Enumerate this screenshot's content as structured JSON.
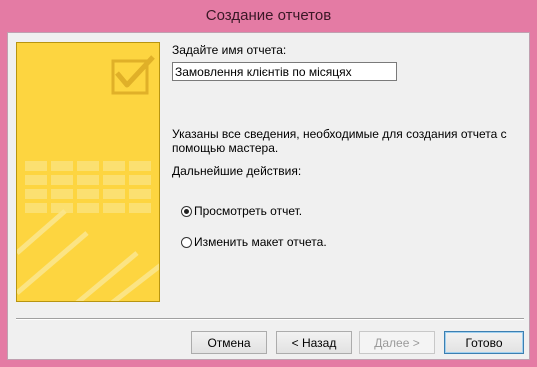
{
  "window": {
    "title": "Создание отчетов"
  },
  "form": {
    "name_label": "Задайте имя отчета:",
    "name_value": "Замовлення клієнтів по місяцях",
    "info_text_line1": "Указаны все сведения, необходимые для создания отчета с",
    "info_text_line2": "помощью мастера.",
    "next_actions_label": "Дальнейшие действия:",
    "options": [
      {
        "label": "Просмотреть отчет.",
        "checked": true
      },
      {
        "label": "Изменить макет отчета.",
        "checked": false
      }
    ]
  },
  "buttons": {
    "cancel": "Отмена",
    "back": "< Назад",
    "next": "Далее >",
    "finish": "Готово"
  },
  "colors": {
    "frame": "#e47ba4",
    "art_background": "#fdd540",
    "dialog": "#f0f0f0"
  },
  "icons": {
    "art": "report-wizard-checkmark-art"
  }
}
